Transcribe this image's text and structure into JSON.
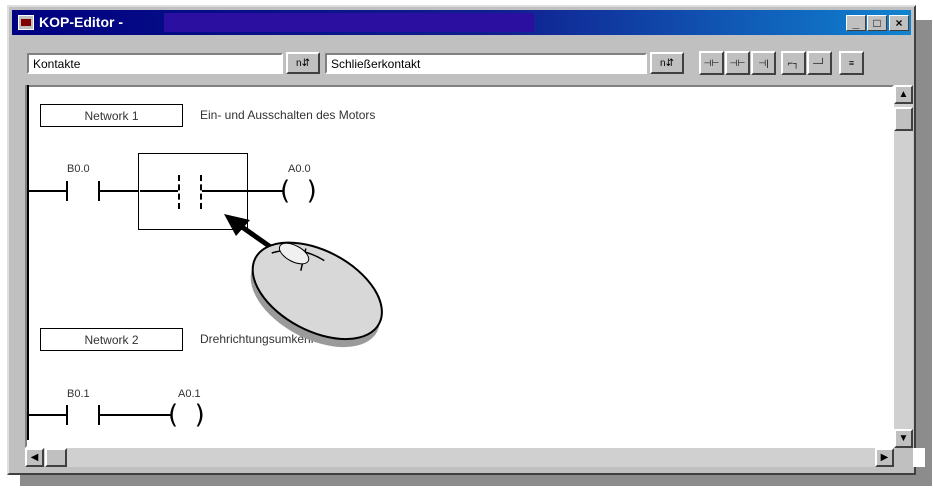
{
  "window": {
    "title": "KOP-Editor -",
    "controls": {
      "minimize": "_",
      "maximize": "□",
      "close": "×"
    }
  },
  "toolbar": {
    "category_value": "Kontakte",
    "element_value": "Schließerkontakt",
    "sort_label": "n"
  },
  "networks": [
    {
      "label": "Network 1",
      "comment": "Ein- und Ausschalten des Motors",
      "contact_address": "B0.0",
      "coil_address": "A0.0"
    },
    {
      "label": "Network 2",
      "comment": "Drehrichtungsumkehr",
      "contact_address": "B0.1",
      "coil_address": "A0.1"
    }
  ],
  "colors": {
    "title_bar": "#000080",
    "window_face": "#c0c0c0",
    "canvas": "#ffffff"
  },
  "icons": [
    "ladder-editor-icon",
    "mouse-pointer-icon",
    "computer-mouse-icon"
  ]
}
